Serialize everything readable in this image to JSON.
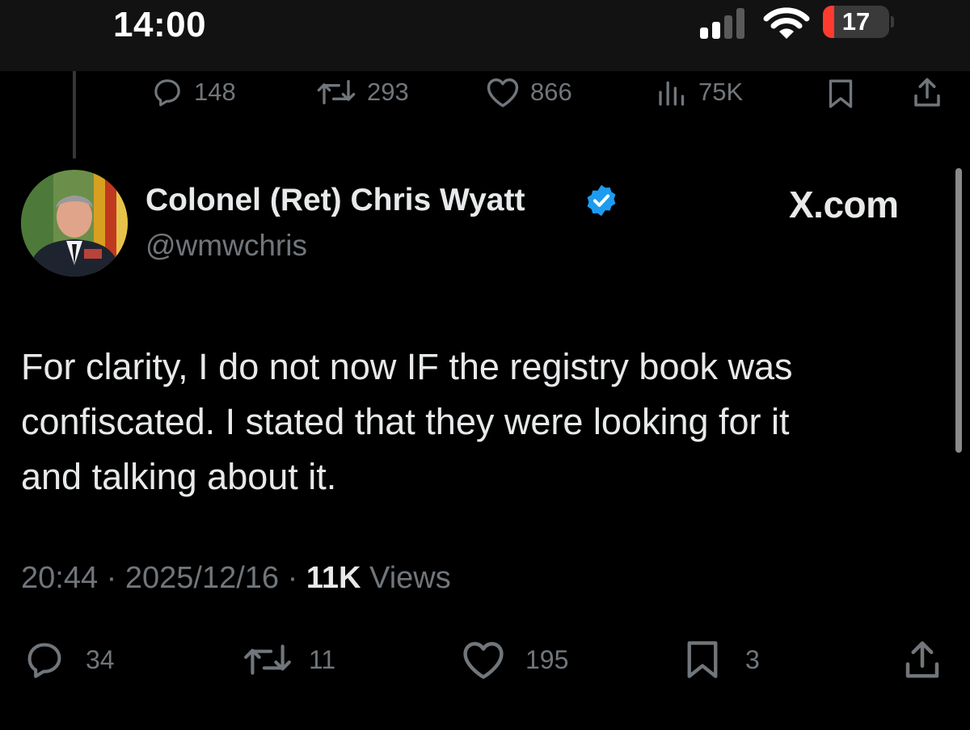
{
  "status_bar": {
    "time": "14:00",
    "battery_level": "17",
    "battery_fraction": 0.17,
    "battery_color": "#ff3b30",
    "icons": [
      "signal-icon",
      "wifi-icon",
      "battery-icon"
    ]
  },
  "parent_tweet": {
    "replies": "148",
    "reposts": "293",
    "likes": "866",
    "views": "75K"
  },
  "tweet": {
    "display_name": "Colonel (Ret) Chris Wyatt",
    "handle": "@wmwchris",
    "source_label": "X.com",
    "text_lines": [
      "For clarity, I do not now IF the registry book was",
      "confiscated.  I stated that they were looking for it",
      "and talking about it."
    ],
    "time": "20:44",
    "date": "2025/12/16",
    "views_count": "11K",
    "views_label": "Views",
    "separator": "·",
    "replies": "34",
    "reposts": "11",
    "likes": "195",
    "bookmarks": "3",
    "verified_color": "#1d9bf0"
  }
}
